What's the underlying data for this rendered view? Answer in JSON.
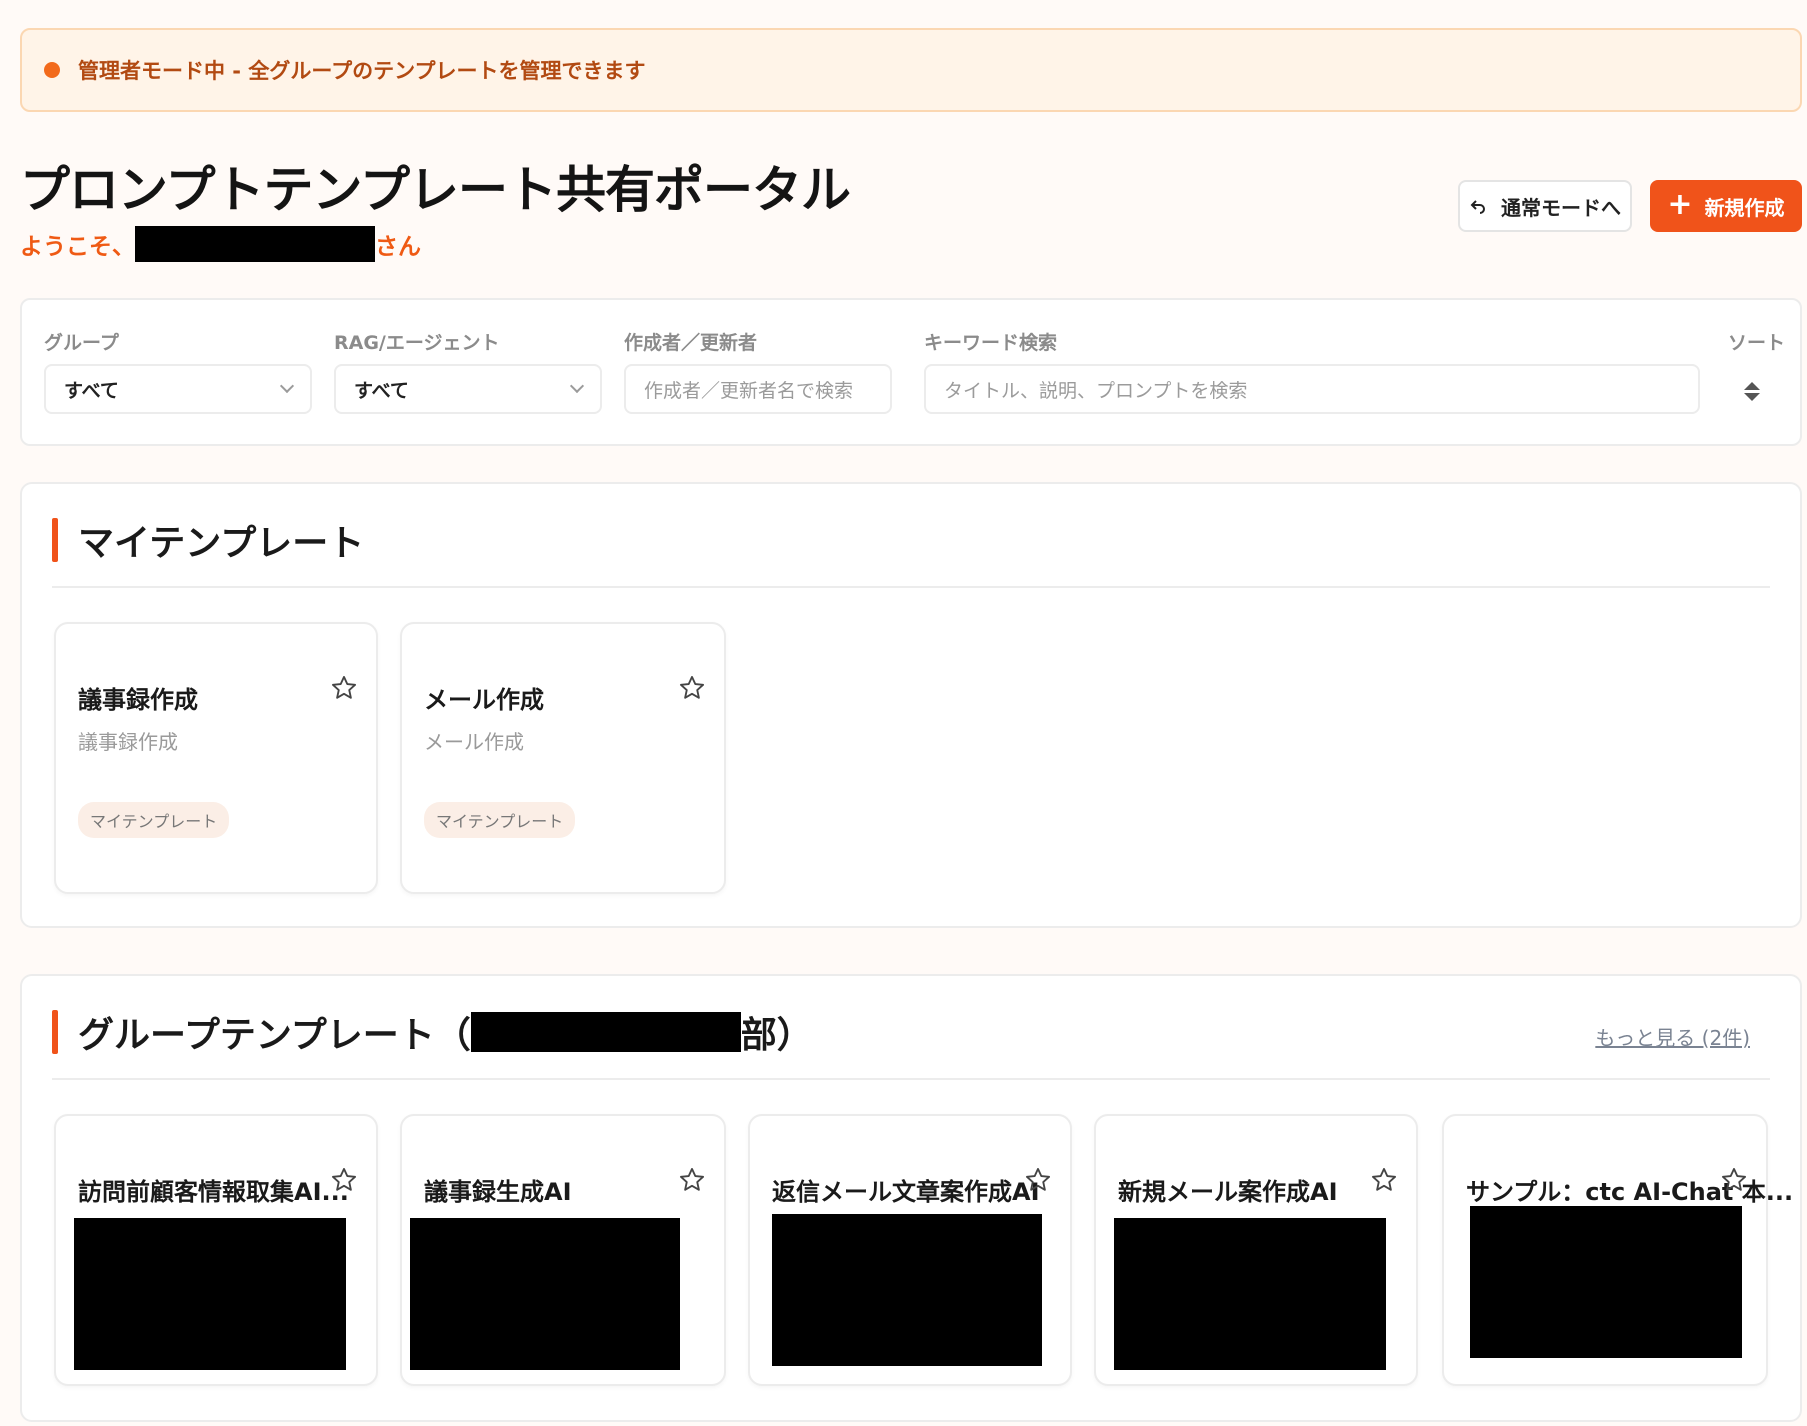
{
  "banner": {
    "message": "管理者モード中 - 全グループのテンプレートを管理できます"
  },
  "header": {
    "title": "プロンプトテンプレート共有ポータル",
    "welcome_prefix": "ようこそ、",
    "welcome_suffix": "さん",
    "normal_mode_label": "通常モードへ",
    "new_label": "新規作成"
  },
  "filters": {
    "group_label": "グループ",
    "group_value": "すべて",
    "rag_label": "RAG/エージェント",
    "rag_value": "すべて",
    "author_label": "作成者／更新者",
    "author_placeholder": "作成者／更新者名で検索",
    "keyword_label": "キーワード検索",
    "keyword_placeholder": "タイトル、説明、プロンプトを検索",
    "sort_label": "ソート"
  },
  "my_templates": {
    "title": "マイテンプレート",
    "cards": [
      {
        "title": "議事録作成",
        "description": "議事録作成",
        "tag": "マイテンプレート"
      },
      {
        "title": "メール作成",
        "description": "メール作成",
        "tag": "マイテンプレート"
      }
    ]
  },
  "group_templates": {
    "title_prefix": "グループテンプレート（",
    "title_suffix": "部）",
    "more_link": "もっと見る (2件)",
    "cards": [
      {
        "title": "訪問前顧客情報取集AI..."
      },
      {
        "title": "議事録生成AI"
      },
      {
        "title": "返信メール文章案作成AI"
      },
      {
        "title": "新規メール案作成AI"
      },
      {
        "title": "サンプル：ctc AI-Chat 本..."
      }
    ]
  },
  "colors": {
    "accent": "#f0531a",
    "banner_bg": "#fff4e8",
    "welcome": "#ef5a14"
  }
}
